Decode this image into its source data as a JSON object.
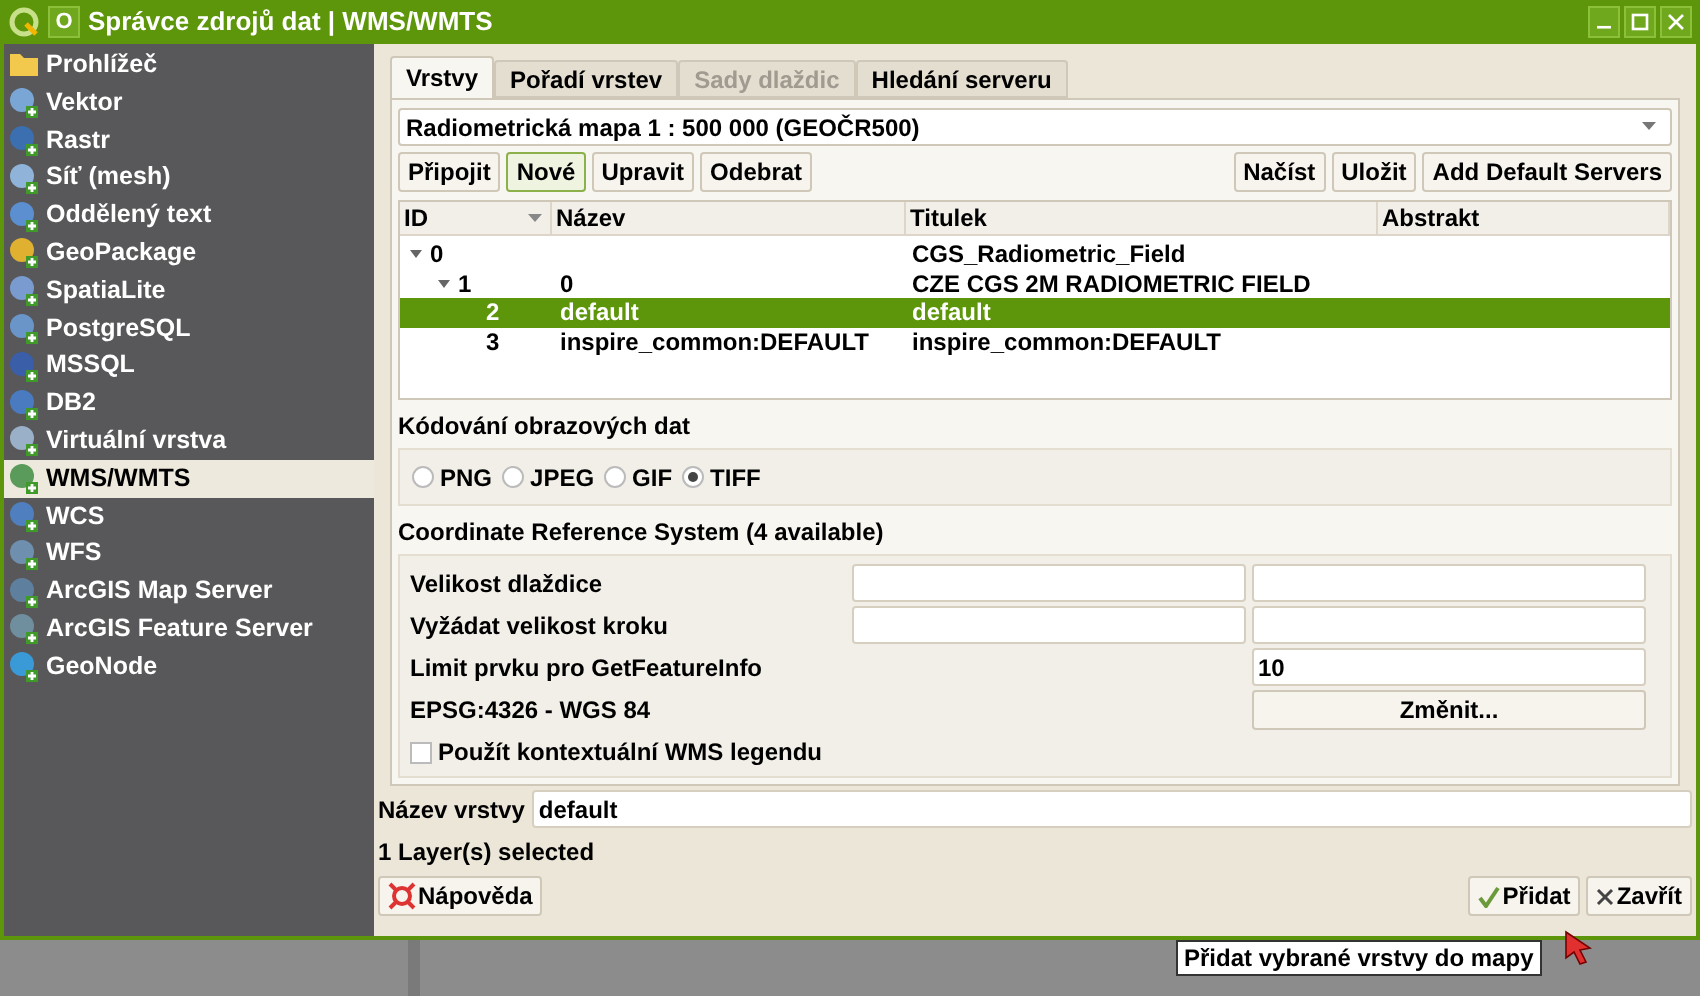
{
  "window": {
    "title": "Správce zdrojů dat | WMS/WMTS",
    "menu_glyph": "O"
  },
  "sidebar": {
    "items": [
      {
        "label": "Prohlížeč",
        "selected": false
      },
      {
        "label": "Vektor",
        "selected": false
      },
      {
        "label": "Rastr",
        "selected": false
      },
      {
        "label": "Síť (mesh)",
        "selected": false
      },
      {
        "label": "Oddělený text",
        "selected": false
      },
      {
        "label": "GeoPackage",
        "selected": false
      },
      {
        "label": "SpatiaLite",
        "selected": false
      },
      {
        "label": "PostgreSQL",
        "selected": false
      },
      {
        "label": "MSSQL",
        "selected": false
      },
      {
        "label": "DB2",
        "selected": false
      },
      {
        "label": "Virtuální vrstva",
        "selected": false
      },
      {
        "label": "WMS/WMTS",
        "selected": true
      },
      {
        "label": "WCS",
        "selected": false
      },
      {
        "label": "WFS",
        "selected": false
      },
      {
        "label": "ArcGIS Map Server",
        "selected": false
      },
      {
        "label": "ArcGIS Feature Server",
        "selected": false
      },
      {
        "label": "GeoNode",
        "selected": false
      }
    ]
  },
  "tabs": [
    {
      "label": "Vrstvy",
      "selected": true,
      "disabled": false
    },
    {
      "label": "Pořadí vrstev",
      "selected": false,
      "disabled": false
    },
    {
      "label": "Sady dlaždic",
      "selected": false,
      "disabled": true
    },
    {
      "label": "Hledání serveru",
      "selected": false,
      "disabled": false
    }
  ],
  "connection": {
    "value": "Radiometrická mapa 1 : 500 000 (GEOČR500)"
  },
  "connection_buttons": [
    {
      "label": "Připojit",
      "focused": false
    },
    {
      "label": "Nové",
      "focused": true
    },
    {
      "label": "Upravit",
      "focused": false
    },
    {
      "label": "Odebrat",
      "focused": false
    }
  ],
  "file_buttons": [
    "Načíst",
    "Uložit",
    "Add Default Servers"
  ],
  "table": {
    "columns": [
      "ID",
      "Název",
      "Titulek",
      "Abstrakt"
    ],
    "rows": [
      {
        "id": "0",
        "name": "",
        "title": "CGS_Radiometric_Field",
        "selected": false,
        "expanded": true,
        "children": [
          {
            "id": "1",
            "name": "0",
            "title": "CZE CGS 2M RADIOMETRIC FIELD",
            "selected": false,
            "expanded": true,
            "children": [
              {
                "id": "2",
                "name": "default",
                "title": "default",
                "selected": true
              },
              {
                "id": "3",
                "name": "inspire_common:DEFAULT",
                "title": "inspire_common:DEFAULT",
                "selected": false
              }
            ]
          }
        ]
      }
    ]
  },
  "encoding": {
    "title": "Kódování obrazových dat",
    "options": [
      {
        "label": "PNG",
        "selected": false
      },
      {
        "label": "JPEG",
        "selected": false
      },
      {
        "label": "GIF",
        "selected": false
      },
      {
        "label": "TIFF",
        "selected": true
      }
    ]
  },
  "crs": {
    "title": "Coordinate Reference System (4 available)",
    "tile_size": {
      "label": "Velikost dlaždice"
    },
    "step_size": {
      "label": "Vyžádat velikost kroku"
    },
    "feature_limit": {
      "label": "Limit prvku pro GetFeatureInfo",
      "value": "10"
    },
    "current": "EPSG:4326 - WGS 84",
    "change_button": "Změnit...",
    "legend": {
      "label": "Použít kontextuální WMS legendu",
      "checked": false
    }
  },
  "layer_name": {
    "label": "Název vrstvy",
    "value": "default"
  },
  "status": "1 Layer(s) selected",
  "help_button": "Nápověda",
  "add_button": "Přidat",
  "close_button": "Zavřít",
  "tooltip": "Přidat vybrané vrstvy do mapy"
}
